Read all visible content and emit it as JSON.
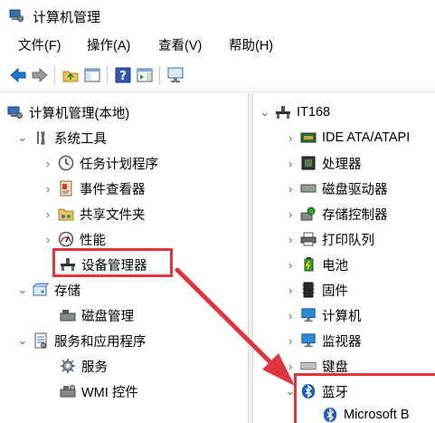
{
  "window": {
    "title": "计算机管理"
  },
  "menu": [
    {
      "label": "文件(F)"
    },
    {
      "label": "操作(A)"
    },
    {
      "label": "查看(V)"
    },
    {
      "label": "帮助(H)"
    }
  ],
  "left_tree": {
    "root": "计算机管理(本地)",
    "system_tools": "系统工具",
    "task_scheduler": "任务计划程序",
    "event_viewer": "事件查看器",
    "shared_folders": "共享文件夹",
    "performance": "性能",
    "device_manager": "设备管理器",
    "storage": "存储",
    "disk_management": "磁盘管理",
    "services_apps": "服务和应用程序",
    "services": "服务",
    "wmi": "WMI 控件"
  },
  "right_tree": {
    "computer": "IT168",
    "items": [
      {
        "label": "IDE ATA/ATAPI"
      },
      {
        "label": "处理器"
      },
      {
        "label": "磁盘驱动器"
      },
      {
        "label": "存储控制器"
      },
      {
        "label": "打印队列"
      },
      {
        "label": "电池"
      },
      {
        "label": "固件"
      },
      {
        "label": "计算机"
      },
      {
        "label": "监视器"
      },
      {
        "label": "键盘"
      },
      {
        "label": "蓝牙"
      },
      {
        "label": "Microsoft B"
      }
    ]
  },
  "colors": {
    "highlight": "#e0353d",
    "accent": "#1e5bbf"
  }
}
